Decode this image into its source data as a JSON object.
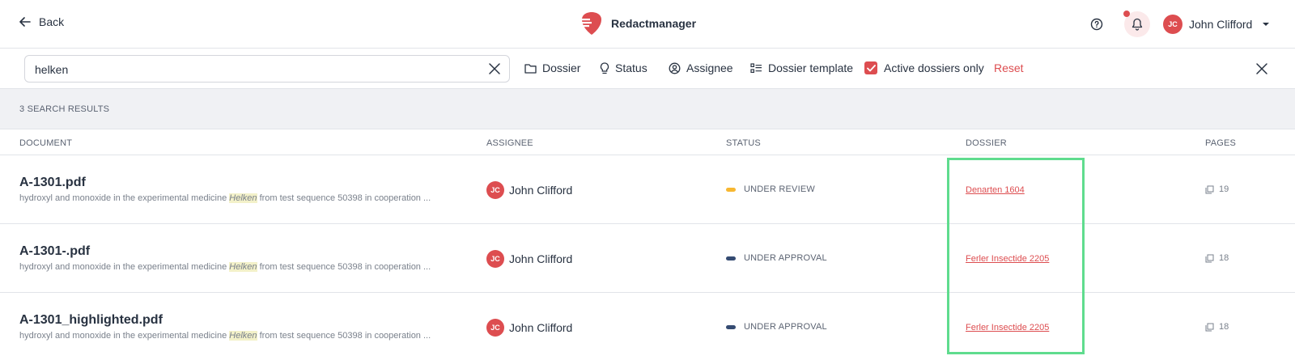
{
  "header": {
    "back_label": "Back",
    "brand_label": "Redactmanager",
    "user_initials": "JC",
    "user_name": "John Clifford"
  },
  "filters": {
    "search_value": "helken",
    "dossier_label": "Dossier",
    "status_label": "Status",
    "assignee_label": "Assignee",
    "dossier_template_label": "Dossier template",
    "active_only_label": "Active dossiers only",
    "active_only_checked": true,
    "reset_label": "Reset"
  },
  "results": {
    "count_label": "3 SEARCH RESULTS",
    "columns": [
      "DOCUMENT",
      "ASSIGNEE",
      "STATUS",
      "DOSSIER",
      "PAGES"
    ],
    "rows": [
      {
        "name": "A-1301.pdf",
        "snippet_before": "hydroxyl and monoxide in the experimental medicine ",
        "snippet_highlight": "Helken",
        "snippet_after": " from test sequence 50398 in cooperation ...",
        "assignee_initials": "JC",
        "assignee_name": "John Clifford",
        "status": "UNDER REVIEW",
        "status_color": "#f7b731",
        "dossier": "Denarten 1604",
        "pages": "19"
      },
      {
        "name": "A-1301-.pdf",
        "snippet_before": "hydroxyl and monoxide in the experimental medicine ",
        "snippet_highlight": "Helken",
        "snippet_after": " from test sequence 50398 in cooperation ...",
        "assignee_initials": "JC",
        "assignee_name": "John Clifford",
        "status": "UNDER APPROVAL",
        "status_color": "#354b72",
        "dossier": "Ferler Insectide 2205",
        "pages": "18"
      },
      {
        "name": "A-1301_highlighted.pdf",
        "snippet_before": "hydroxyl and monoxide in the experimental medicine ",
        "snippet_highlight": "Helken",
        "snippet_after": " from test sequence 50398 in cooperation ...",
        "assignee_initials": "JC",
        "assignee_name": "John Clifford",
        "status": "UNDER APPROVAL",
        "status_color": "#354b72",
        "dossier": "Ferler Insectide 2205",
        "pages": "18"
      }
    ]
  },
  "colors": {
    "accent": "#dd4d50",
    "highlight_box": "#5fdc8e"
  }
}
